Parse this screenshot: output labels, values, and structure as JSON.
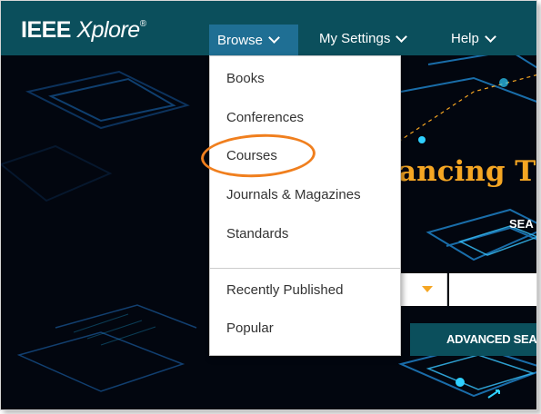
{
  "header": {
    "logo_ieee": "IEEE",
    "logo_xplore": "Xplore",
    "logo_reg": "®",
    "nav": {
      "browse": "Browse",
      "my_settings": "My Settings",
      "help": "Help"
    }
  },
  "browse_menu": {
    "items": [
      "Books",
      "Conferences",
      "Courses",
      "Journals & Magazines",
      "Standards"
    ],
    "secondary_items": [
      "Recently Published",
      "Popular"
    ],
    "highlighted_item": "Courses"
  },
  "hero": {
    "title_fragment": "ancing T",
    "search_tab_fragment": "SEA",
    "search_input_value": "",
    "advanced_search_label": "ADVANCED SEA"
  },
  "colors": {
    "topbar": "#0b4f5c",
    "browse_active": "#1f6f94",
    "accent_orange": "#f5a623",
    "annotation_orange": "#f07f1e",
    "hero_background": "#02060f"
  }
}
